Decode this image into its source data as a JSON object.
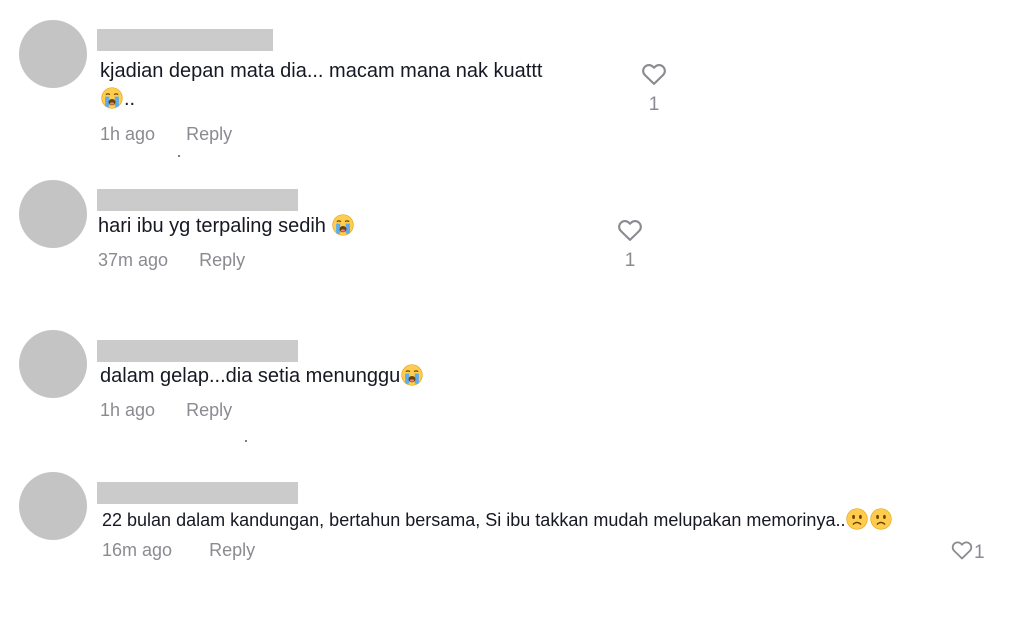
{
  "comments": [
    {
      "text_line1": "kjadian depan mata dia... macam mana nak kuattt",
      "text_line2_suffix": "..",
      "emoji": "loudly-crying-face-icon",
      "time": "1h ago",
      "reply_label": "Reply",
      "likes": "1"
    },
    {
      "text": "hari ibu yg terpaling sedih",
      "emoji": "loudly-crying-face-icon",
      "time": "37m ago",
      "reply_label": "Reply",
      "likes": "1"
    },
    {
      "text": "dalam gelap...dia setia menunggu",
      "emoji": "loudly-crying-face-icon",
      "time": "1h ago",
      "reply_label": "Reply"
    },
    {
      "text": "22 bulan dalam kandungan, bertahun bersama, Si ibu takkan mudah melupakan memorinya..",
      "emoji": "sad-face-icon",
      "time": "16m ago",
      "reply_label": "Reply",
      "likes": "1"
    }
  ],
  "colors": {
    "text": "#161823",
    "secondary": "#8a8b91",
    "avatar": "#c4c4c4",
    "redaction": "#cbcbcb"
  }
}
